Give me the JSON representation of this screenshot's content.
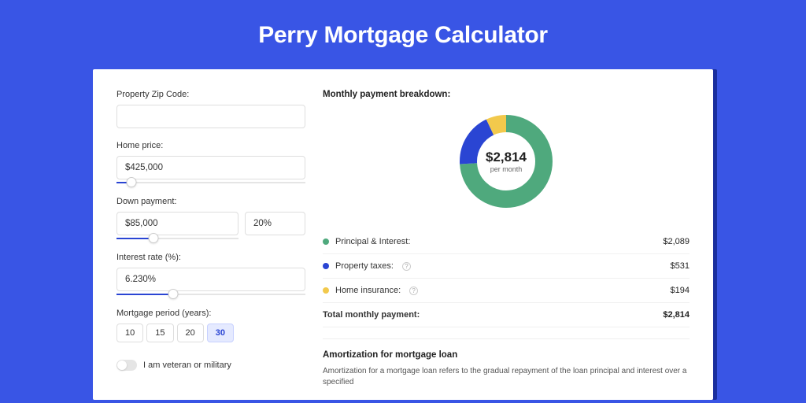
{
  "title": "Perry Mortgage Calculator",
  "form": {
    "zip": {
      "label": "Property Zip Code:",
      "value": ""
    },
    "homePrice": {
      "label": "Home price:",
      "value": "$425,000",
      "sliderPct": 8
    },
    "downPayment": {
      "label": "Down payment:",
      "amount": "$85,000",
      "percent": "20%",
      "sliderPct": 20
    },
    "interest": {
      "label": "Interest rate (%):",
      "value": "6.230%",
      "sliderPct": 30
    },
    "period": {
      "label": "Mortgage period (years):",
      "options": [
        "10",
        "15",
        "20",
        "30"
      ],
      "active": 3
    },
    "veteran": {
      "label": "I am veteran or military",
      "value": false
    }
  },
  "breakdown": {
    "title": "Monthly payment breakdown:",
    "center": {
      "amount": "$2,814",
      "sub": "per month"
    },
    "rows": [
      {
        "color": "#4fa97d",
        "label": "Principal & Interest:",
        "value": "$2,089",
        "help": false
      },
      {
        "color": "#2a45d3",
        "label": "Property taxes:",
        "value": "$531",
        "help": true
      },
      {
        "color": "#f2c94c",
        "label": "Home insurance:",
        "value": "$194",
        "help": true
      }
    ],
    "total": {
      "label": "Total monthly payment:",
      "value": "$2,814"
    }
  },
  "chart_data": {
    "type": "pie",
    "title": "Monthly payment breakdown",
    "categories": [
      "Principal & Interest",
      "Property taxes",
      "Home insurance"
    ],
    "values": [
      2089,
      531,
      194
    ],
    "colors": [
      "#4fa97d",
      "#2a45d3",
      "#f2c94c"
    ],
    "total": 2814,
    "center_label": "$2,814 per month"
  },
  "amort": {
    "title": "Amortization for mortgage loan",
    "text": "Amortization for a mortgage loan refers to the gradual repayment of the loan principal and interest over a specified"
  }
}
